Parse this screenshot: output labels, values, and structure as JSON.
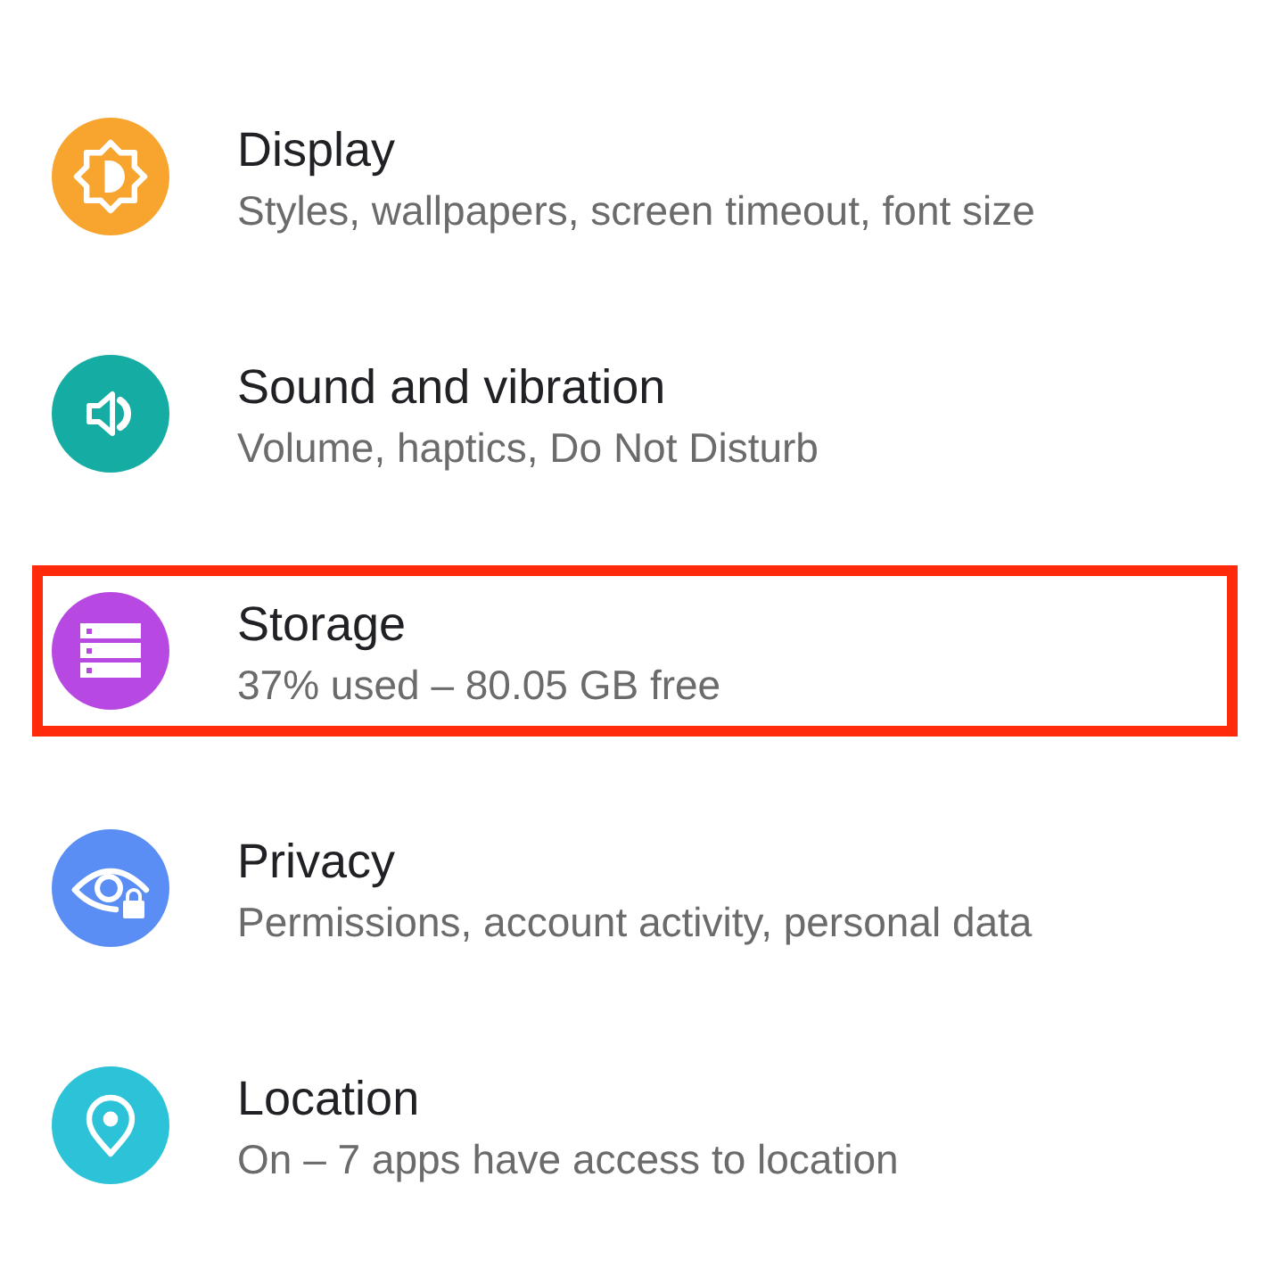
{
  "items": [
    {
      "kind": "brightness",
      "color": "#f8a530",
      "title": "Display",
      "subtitle": "Styles, wallpapers, screen timeout, font size",
      "highlighted": false
    },
    {
      "kind": "volume",
      "color": "#14aca3",
      "title": "Sound and vibration",
      "subtitle": "Volume, haptics, Do Not Disturb",
      "highlighted": false
    },
    {
      "kind": "storage",
      "color": "#b748e1",
      "title": "Storage",
      "subtitle": "37% used – 80.05 GB free",
      "highlighted": true
    },
    {
      "kind": "privacy",
      "color": "#5b8ef5",
      "title": "Privacy",
      "subtitle": "Permissions, account activity, personal data",
      "highlighted": false
    },
    {
      "kind": "location",
      "color": "#2cc3d8",
      "title": "Location",
      "subtitle": "On – 7 apps have access to location",
      "highlighted": false
    }
  ]
}
